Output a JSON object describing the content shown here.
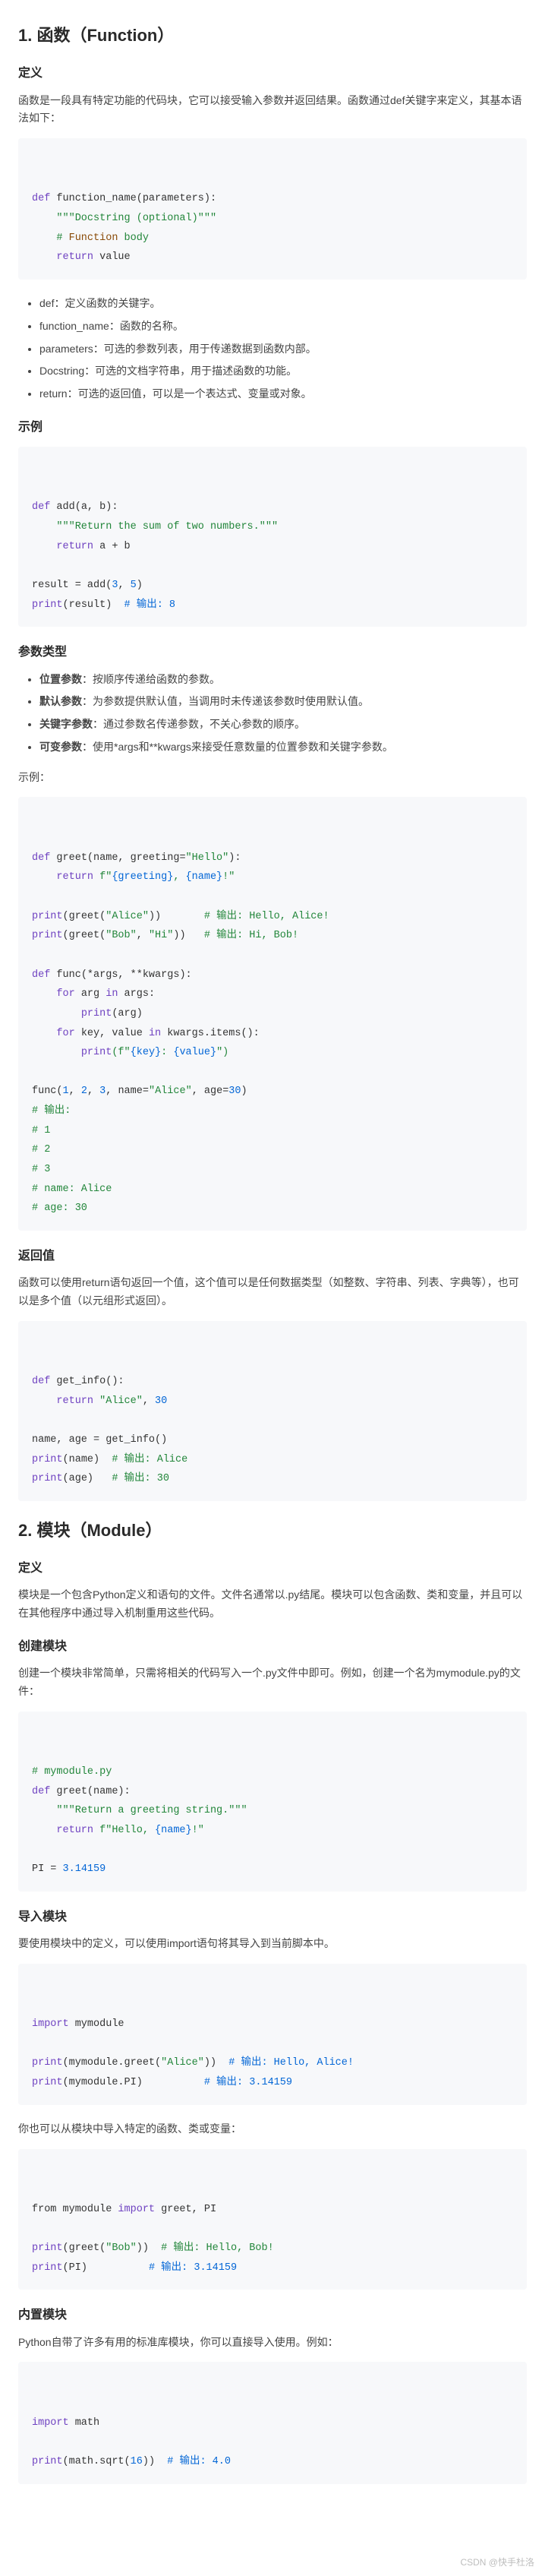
{
  "watermark": "CSDN @快手杜洛",
  "s1": {
    "title": "1. 函数（Function）",
    "def_h": "定义",
    "def_p": "函数是一段具有特定功能的代码块，它可以接受输入参数并返回结果。函数通过def关键字来定义，其基本语法如下：",
    "code1": {
      "l1a": "def",
      "l1b": " function_name(parameters):",
      "l2": "\"\"\"Docstring (optional)\"\"\"",
      "l3a": "# ",
      "l3b": "Function",
      "l3c": " body",
      "l4a": "return",
      "l4b": " value"
    },
    "bullets1": [
      "def：定义函数的关键字。",
      "function_name：函数的名称。",
      "parameters：可选的参数列表，用于传递数据到函数内部。",
      "Docstring：可选的文档字符串，用于描述函数的功能。",
      "return：可选的返回值，可以是一个表达式、变量或对象。"
    ],
    "ex_h": "示例",
    "code2": {
      "l1a": "def",
      "l1b": " add(a, b):",
      "l2": "\"\"\"Return the sum of two numbers.\"\"\"",
      "l3a": "return",
      "l3b": " a + b",
      "l4a": "result = add(",
      "l4b": "3",
      "l4c": ", ",
      "l4d": "5",
      "l4e": ")",
      "l5a": "print",
      "l5b": "(result)  ",
      "l5c": "# 输出: 8"
    },
    "ptype_h": "参数类型",
    "bullets2": [
      {
        "b": "位置参数",
        "t": "：按顺序传递给函数的参数。"
      },
      {
        "b": "默认参数",
        "t": "：为参数提供默认值，当调用时未传递该参数时使用默认值。"
      },
      {
        "b": "关键字参数",
        "t": "：通过参数名传递参数，不关心参数的顺序。"
      },
      {
        "b": "可变参数",
        "t": "：使用*args和**kwargs来接受任意数量的位置参数和关键字参数。"
      }
    ],
    "ex_label": "示例：",
    "code3": {
      "l1a": "def",
      "l1b": " greet(name, greeting=",
      "l1c": "\"Hello\"",
      "l1d": "):",
      "l2a": "return",
      "l2b": " f\"",
      "l2c": "{greeting}",
      "l2d": ", ",
      "l2e": "{name}",
      "l2f": "!\"",
      "l3a": "print",
      "l3b": "(greet(",
      "l3c": "\"Alice\"",
      "l3d": "))       ",
      "l3e": "# 输出: Hello, Alice!",
      "l4a": "print",
      "l4b": "(greet(",
      "l4c": "\"Bob\"",
      "l4d": ", ",
      "l4e": "\"Hi\"",
      "l4f": "))   ",
      "l4g": "# 输出: Hi, Bob!",
      "l5a": "def",
      "l5b": " func(*args, **kwargs):",
      "l6a": "for",
      "l6b": " arg ",
      "l6c": "in",
      "l6d": " args:",
      "l7a": "print",
      "l7b": "(arg)",
      "l8a": "for",
      "l8b": " key, value ",
      "l8c": "in",
      "l8d": " kwargs.items():",
      "l9a": "print",
      "l9b": "(f\"",
      "l9c": "{key}",
      "l9d": ": ",
      "l9e": "{value}",
      "l9f": "\")",
      "l10a": "func(",
      "l10b": "1",
      "l10c": ", ",
      "l10d": "2",
      "l10e": ", ",
      "l10f": "3",
      "l10g": ", name=",
      "l10h": "\"Alice\"",
      "l10i": ", age=",
      "l10j": "30",
      "l10k": ")",
      "l11": "# 输出:",
      "l12": "# 1",
      "l13": "# 2",
      "l14": "# 3",
      "l15": "# name: Alice",
      "l16": "# age: 30"
    },
    "ret_h": "返回值",
    "ret_p": "函数可以使用return语句返回一个值，这个值可以是任何数据类型（如整数、字符串、列表、字典等），也可以是多个值（以元组形式返回）。",
    "code4": {
      "l1a": "def",
      "l1b": " get_info():",
      "l2a": "return",
      "l2b": " ",
      "l2c": "\"Alice\"",
      "l2d": ", ",
      "l2e": "30",
      "l3": "name, age = get_info()",
      "l4a": "print",
      "l4b": "(name)  ",
      "l4c": "# 输出: Alice",
      "l5a": "print",
      "l5b": "(age)   ",
      "l5c": "# 输出: 30"
    }
  },
  "s2": {
    "title": "2. 模块（Module）",
    "def_h": "定义",
    "def_p": "模块是一个包含Python定义和语句的文件。文件名通常以.py结尾。模块可以包含函数、类和变量，并且可以在其他程序中通过导入机制重用这些代码。",
    "create_h": "创建模块",
    "create_p": "创建一个模块非常简单，只需将相关的代码写入一个.py文件中即可。例如，创建一个名为mymodule.py的文件：",
    "code5": {
      "l1": "# mymodule.py",
      "l2a": "def",
      "l2b": " greet(name):",
      "l3": "\"\"\"Return a greeting string.\"\"\"",
      "l4a": "return",
      "l4b": " f\"Hello, ",
      "l4c": "{name}",
      "l4d": "!\"",
      "l5a": "PI = ",
      "l5b": "3.14159"
    },
    "import_h": "导入模块",
    "import_p": "要使用模块中的定义，可以使用import语句将其导入到当前脚本中。",
    "code6": {
      "l1a": "import",
      "l1b": " mymodule",
      "l2a": "print",
      "l2b": "(mymodule.greet(",
      "l2c": "\"Alice\"",
      "l2d": "))  ",
      "l2e": "# 输出: Hello, Alice!",
      "l3a": "print",
      "l3b": "(mymodule.PI)          ",
      "l3c": "# 输出: 3.14159"
    },
    "import_p2": "你也可以从模块中导入特定的函数、类或变量：",
    "code7": {
      "l1a": "from mymodule ",
      "l1b": "import",
      "l1c": " greet, PI",
      "l2a": "print",
      "l2b": "(greet(",
      "l2c": "\"Bob\"",
      "l2d": "))  ",
      "l2e": "# 输出: Hello, Bob!",
      "l3a": "print",
      "l3b": "(PI)          ",
      "l3c": "# 输出: 3.14159"
    },
    "builtin_h": "内置模块",
    "builtin_p": "Python自带了许多有用的标准库模块，你可以直接导入使用。例如：",
    "code8": {
      "l1a": "import",
      "l1b": " math",
      "l2a": "print",
      "l2b": "(math.sqrt(",
      "l2c": "16",
      "l2d": "))  ",
      "l2e": "# 输出: 4.0"
    }
  }
}
